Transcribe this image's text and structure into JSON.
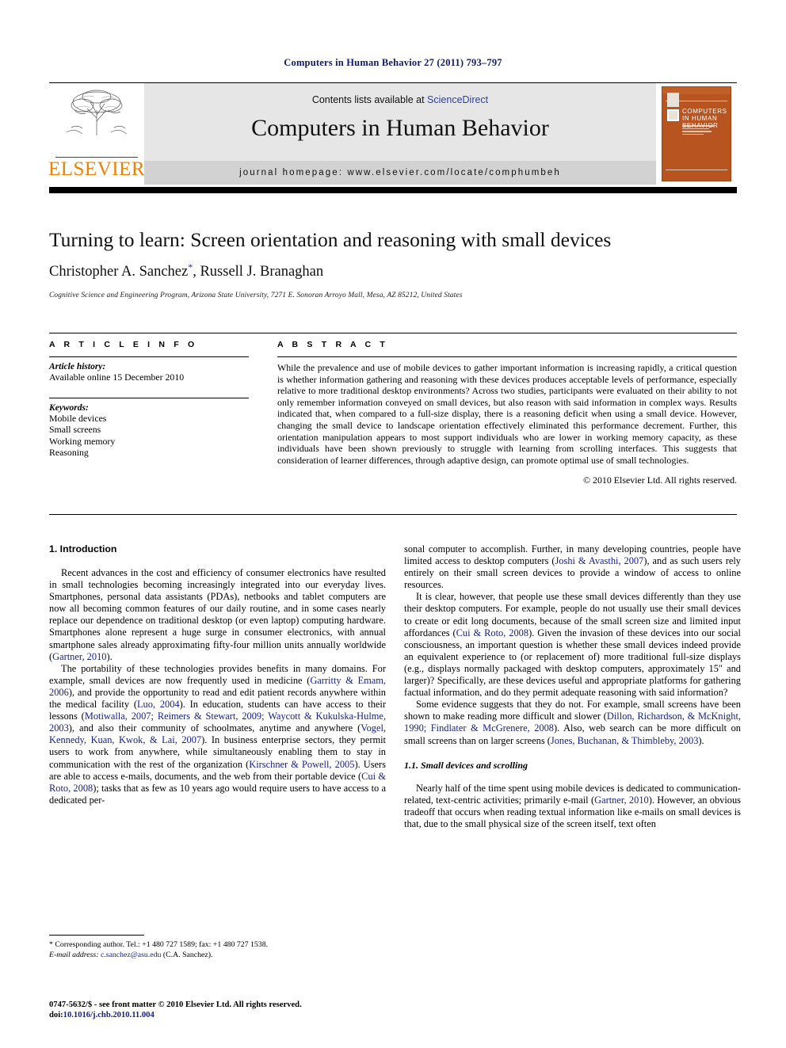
{
  "running_head": "Computers in Human Behavior 27 (2011) 793–797",
  "masthead": {
    "publisher": "ELSEVIER",
    "contents_prefix": "Contents lists available at ",
    "contents_link": "ScienceDirect",
    "journal_name": "Computers in Human Behavior",
    "homepage": "journal homepage: www.elsevier.com/locate/comphumbeh",
    "cover_title": "COMPUTERS IN HUMAN BEHAVIOR",
    "link_color": "#2b3fae",
    "brand_color": "#f08000",
    "cover_color": "#b8541f"
  },
  "article": {
    "title": "Turning to learn: Screen orientation and reasoning with small devices",
    "authors": "Christopher A. Sanchez",
    "authors_rest": ", Russell J. Branaghan",
    "corresponding_marker": "*",
    "affiliation": "Cognitive Science and Engineering Program, Arizona State University, 7271 E. Sonoran Arroyo Mall, Mesa, AZ 85212, United States"
  },
  "info": {
    "heading": "A R T I C L E   I N F O",
    "history_label": "Article history:",
    "history_value": "Available online 15 December 2010",
    "keywords_label": "Keywords:",
    "keywords": [
      "Mobile devices",
      "Small screens",
      "Working memory",
      "Reasoning"
    ]
  },
  "abstract": {
    "heading": "A B S T R A C T",
    "text": "While the prevalence and use of mobile devices to gather important information is increasing rapidly, a critical question is whether information gathering and reasoning with these devices produces acceptable levels of performance, especially relative to more traditional desktop environments? Across two studies, participants were evaluated on their ability to not only remember information conveyed on small devices, but also reason with said information in complex ways. Results indicated that, when compared to a full-size display, there is a reasoning deficit when using a small device. However, changing the small device to landscape orientation effectively eliminated this performance decrement. Further, this orientation manipulation appears to most support individuals who are lower in working memory capacity, as these individuals have been shown previously to struggle with learning from scrolling interfaces. This suggests that consideration of learner differences, through adaptive design, can promote optimal use of small technologies.",
    "copyright": "© 2010 Elsevier Ltd. All rights reserved."
  },
  "body": {
    "section1_heading": "1. Introduction",
    "left_p1_a": "Recent advances in the cost and efficiency of consumer electronics have resulted in small technologies becoming increasingly integrated into our everyday lives. Smartphones, personal data assistants (PDAs), netbooks and tablet computers are now all becoming common features of our daily routine, and in some cases nearly replace our dependence on traditional desktop (or even laptop) computing hardware. Smartphones alone represent a huge surge in consumer electronics, with annual smartphone sales already approximating fifty-four million units annually worldwide (",
    "left_p1_ref1": "Gartner, 2010",
    "left_p1_b": ").",
    "left_p2_a": "The portability of these technologies provides benefits in many domains. For example, small devices are now frequently used in medicine (",
    "left_p2_ref1": "Garritty & Emam, 2006",
    "left_p2_b": "), and provide the opportunity to read and edit patient records anywhere within the medical facility (",
    "left_p2_ref2": "Luo, 2004",
    "left_p2_c": "). In education, students can have access to their lessons (",
    "left_p2_ref3": "Motiwalla, 2007; Reimers & Stewart, 2009; Waycott & Kukulska-Hulme, 2003",
    "left_p2_d": "), and also their community of schoolmates, anytime and anywhere (",
    "left_p2_ref4": "Vogel, Kennedy, Kuan, Kwok, & Lai, 2007",
    "left_p2_e": "). In business enterprise sectors, they permit users to work from anywhere, while simultaneously enabling them to stay in communication with the rest of the organization (",
    "left_p2_ref5": "Kirschner & Powell, 2005",
    "left_p2_f": "). Users are able to access e-mails, documents, and the web from their portable device (",
    "left_p2_ref6": "Cui & Roto, 2008",
    "left_p2_g": "); tasks that as few as 10 years ago would require users to have access to a dedicated per-",
    "right_p1_a": "sonal computer to accomplish. Further, in many developing countries, people have limited access to desktop computers (",
    "right_p1_ref1": "Joshi & Avasthi, 2007",
    "right_p1_b": "), and as such users rely entirely on their small screen devices to provide a window of access to online resources.",
    "right_p2_a": "It is clear, however, that people use these small devices differently than they use their desktop computers. For example, people do not usually use their small devices to create or edit long documents, because of the small screen size and limited input affordances (",
    "right_p2_ref1": "Cui & Roto, 2008",
    "right_p2_b": "). Given the invasion of these devices into our social consciousness, an important question is whether these small devices indeed provide an equivalent experience to (or replacement of) more traditional full-size displays (e.g., displays normally packaged with desktop computers, approximately 15″ and larger)? Specifically, are these devices useful and appropriate platforms for gathering factual information, and do they permit adequate reasoning with said information?",
    "right_p3_a": "Some evidence suggests that they do not. For example, small screens have been shown to make reading more difficult and slower (",
    "right_p3_ref1": "Dillon, Richardson, & McKnight, 1990; Findlater & McGrenere, 2008",
    "right_p3_b": "). Also, web search can be more difficult on small screens than on larger screens (",
    "right_p3_ref2": "Jones, Buchanan, & Thimbleby, 2003",
    "right_p3_c": ").",
    "section11_heading": "1.1. Small devices and scrolling",
    "right_p4_a": "Nearly half of the time spent using mobile devices is dedicated to communication-related, text-centric activities; primarily e-mail (",
    "right_p4_ref1": "Gartner, 2010",
    "right_p4_b": "). However, an obvious tradeoff that occurs when reading textual information like e-mails on small devices is that, due to the small physical size of the screen itself, text often"
  },
  "footnote": {
    "corresponding": "* Corresponding author. Tel.: +1 480 727 1589; fax: +1 480 727 1538.",
    "email_label": "E-mail address:",
    "email": "c.sanchez@asu.edu",
    "email_suffix": " (C.A. Sanchez).",
    "issn_line": "0747-5632/$ - see front matter © 2010 Elsevier Ltd. All rights reserved.",
    "doi_label": "doi:",
    "doi_value": "10.1016/j.chb.2010.11.004"
  }
}
